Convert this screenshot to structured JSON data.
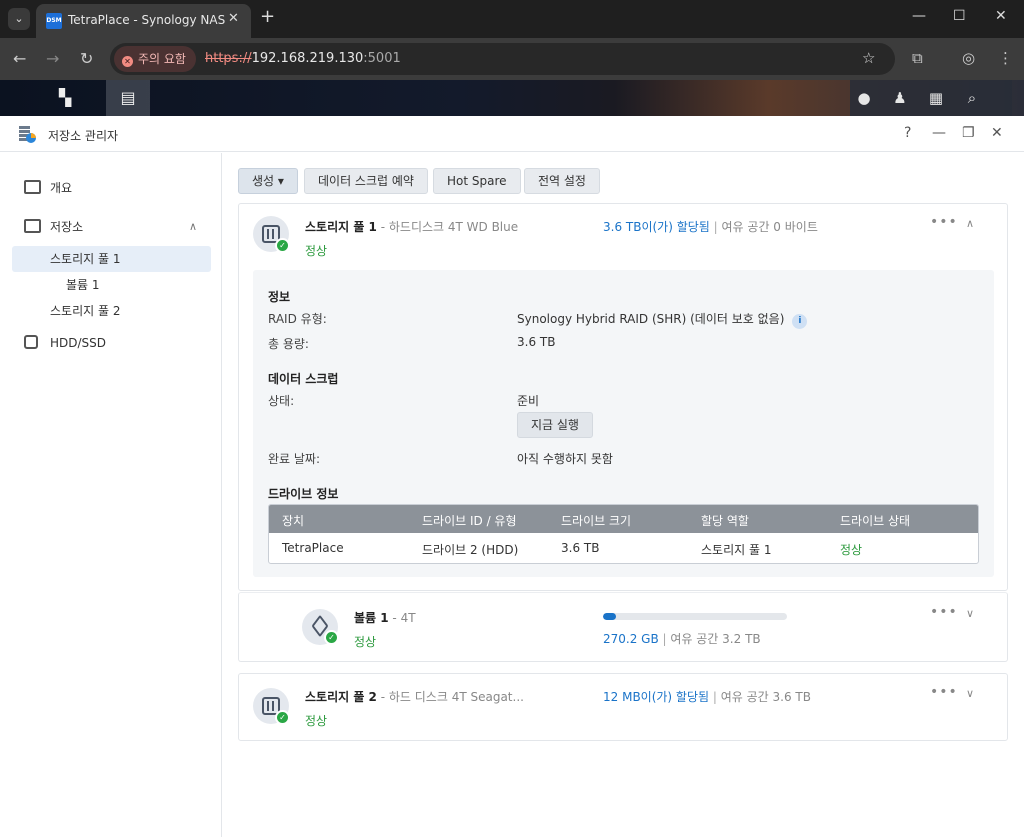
{
  "browser": {
    "tab_title": "TetraPlace - Synology NAS",
    "favicon_text": "DSM",
    "security_warning": "주의 요함",
    "url_scheme": "https://",
    "url_host": "192.168.219.130",
    "url_port": ":5001"
  },
  "app": {
    "title": "저장소 관리자",
    "help": "?"
  },
  "sidebar": {
    "overview": "개요",
    "storage": "저장소",
    "pool1": "스토리지 풀 1",
    "volume1": "볼륨 1",
    "pool2": "스토리지 풀 2",
    "hdd": "HDD/SSD"
  },
  "toolbar": {
    "create": "생성 ▾",
    "scrub_schedule": "데이터 스크럽 예약",
    "hot_spare": "Hot Spare",
    "global_settings": "전역 설정"
  },
  "pool1": {
    "name": "스토리지 풀 1",
    "subtitle": " - 하드디스크 4T WD Blue",
    "status": "정상",
    "allocated": "3.6 TB이(가) 할당됨",
    "separator": " | ",
    "free": "여유 공간 0 바이트",
    "info_title": "정보",
    "raid_label": "RAID 유형:",
    "raid_value": "Synology Hybrid RAID (SHR) (데이터 보호 없음)",
    "capacity_label": "총 용량:",
    "capacity_value": "3.6 TB",
    "scrub_title": "데이터 스크럽",
    "scrub_status_label": "상태:",
    "scrub_status_value": "준비",
    "run_now": "지금 실행",
    "completed_label": "완료 날짜:",
    "completed_value": "아직 수행하지 못함",
    "drive_info_title": "드라이브 정보",
    "table_headers": [
      "장치",
      "드라이브 ID / 유형",
      "드라이브 크기",
      "할당 역할",
      "드라이브 상태"
    ],
    "table_row": [
      "TetraPlace",
      "드라이브 2 (HDD)",
      "3.6 TB",
      "스토리지 풀 1",
      "정상"
    ]
  },
  "volume1": {
    "name": "볼륨 1",
    "subtitle": " - 4T",
    "status": "정상",
    "used": "270.2 GB",
    "separator": " | ",
    "free": "여유 공간 3.2 TB",
    "usage_fraction": 0.07
  },
  "pool2": {
    "name": "스토리지 풀 2",
    "subtitle": " - 하드 디스크 4T Seagat...",
    "status": "정상",
    "allocated": "12 MB이(가) 할당됨",
    "separator": " | ",
    "free": "여유 공간 3.6 TB"
  },
  "colors": {
    "accent": "#1a73c8",
    "ok": "#2d9a3e"
  }
}
